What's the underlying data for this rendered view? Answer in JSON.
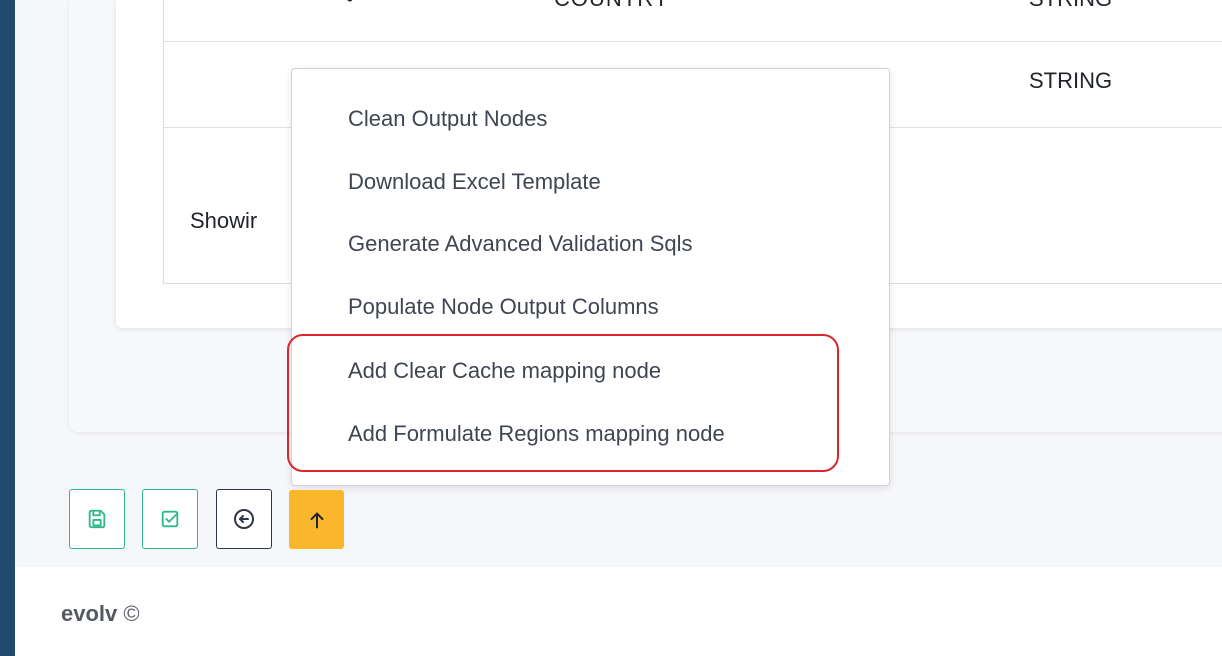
{
  "table": {
    "row1": {
      "col_a": "•",
      "col_b": "COUNTRY",
      "type": "STRING"
    },
    "row2": {
      "type": "STRING"
    },
    "showing_text": "Showir"
  },
  "context_menu": {
    "items": [
      {
        "label": "Clean Output Nodes"
      },
      {
        "label": "Download Excel Template"
      },
      {
        "label": "Generate Advanced Validation Sqls"
      },
      {
        "label": "Populate Node Output Columns"
      },
      {
        "label": "Add Clear Cache mapping node"
      },
      {
        "label": "Add Formulate Regions mapping node"
      }
    ]
  },
  "toolbar": {
    "save_icon": "save-icon",
    "validate_icon": "checkbox-icon",
    "back_icon": "circle-arrow-left-icon",
    "up_icon": "arrow-up-icon"
  },
  "footer": {
    "brand": "evolv",
    "copyright": "©"
  },
  "colors": {
    "frame": "#24496f",
    "highlight": "#d9262e",
    "green_border": "#2fb98a",
    "up_button": "#fbb72b"
  }
}
